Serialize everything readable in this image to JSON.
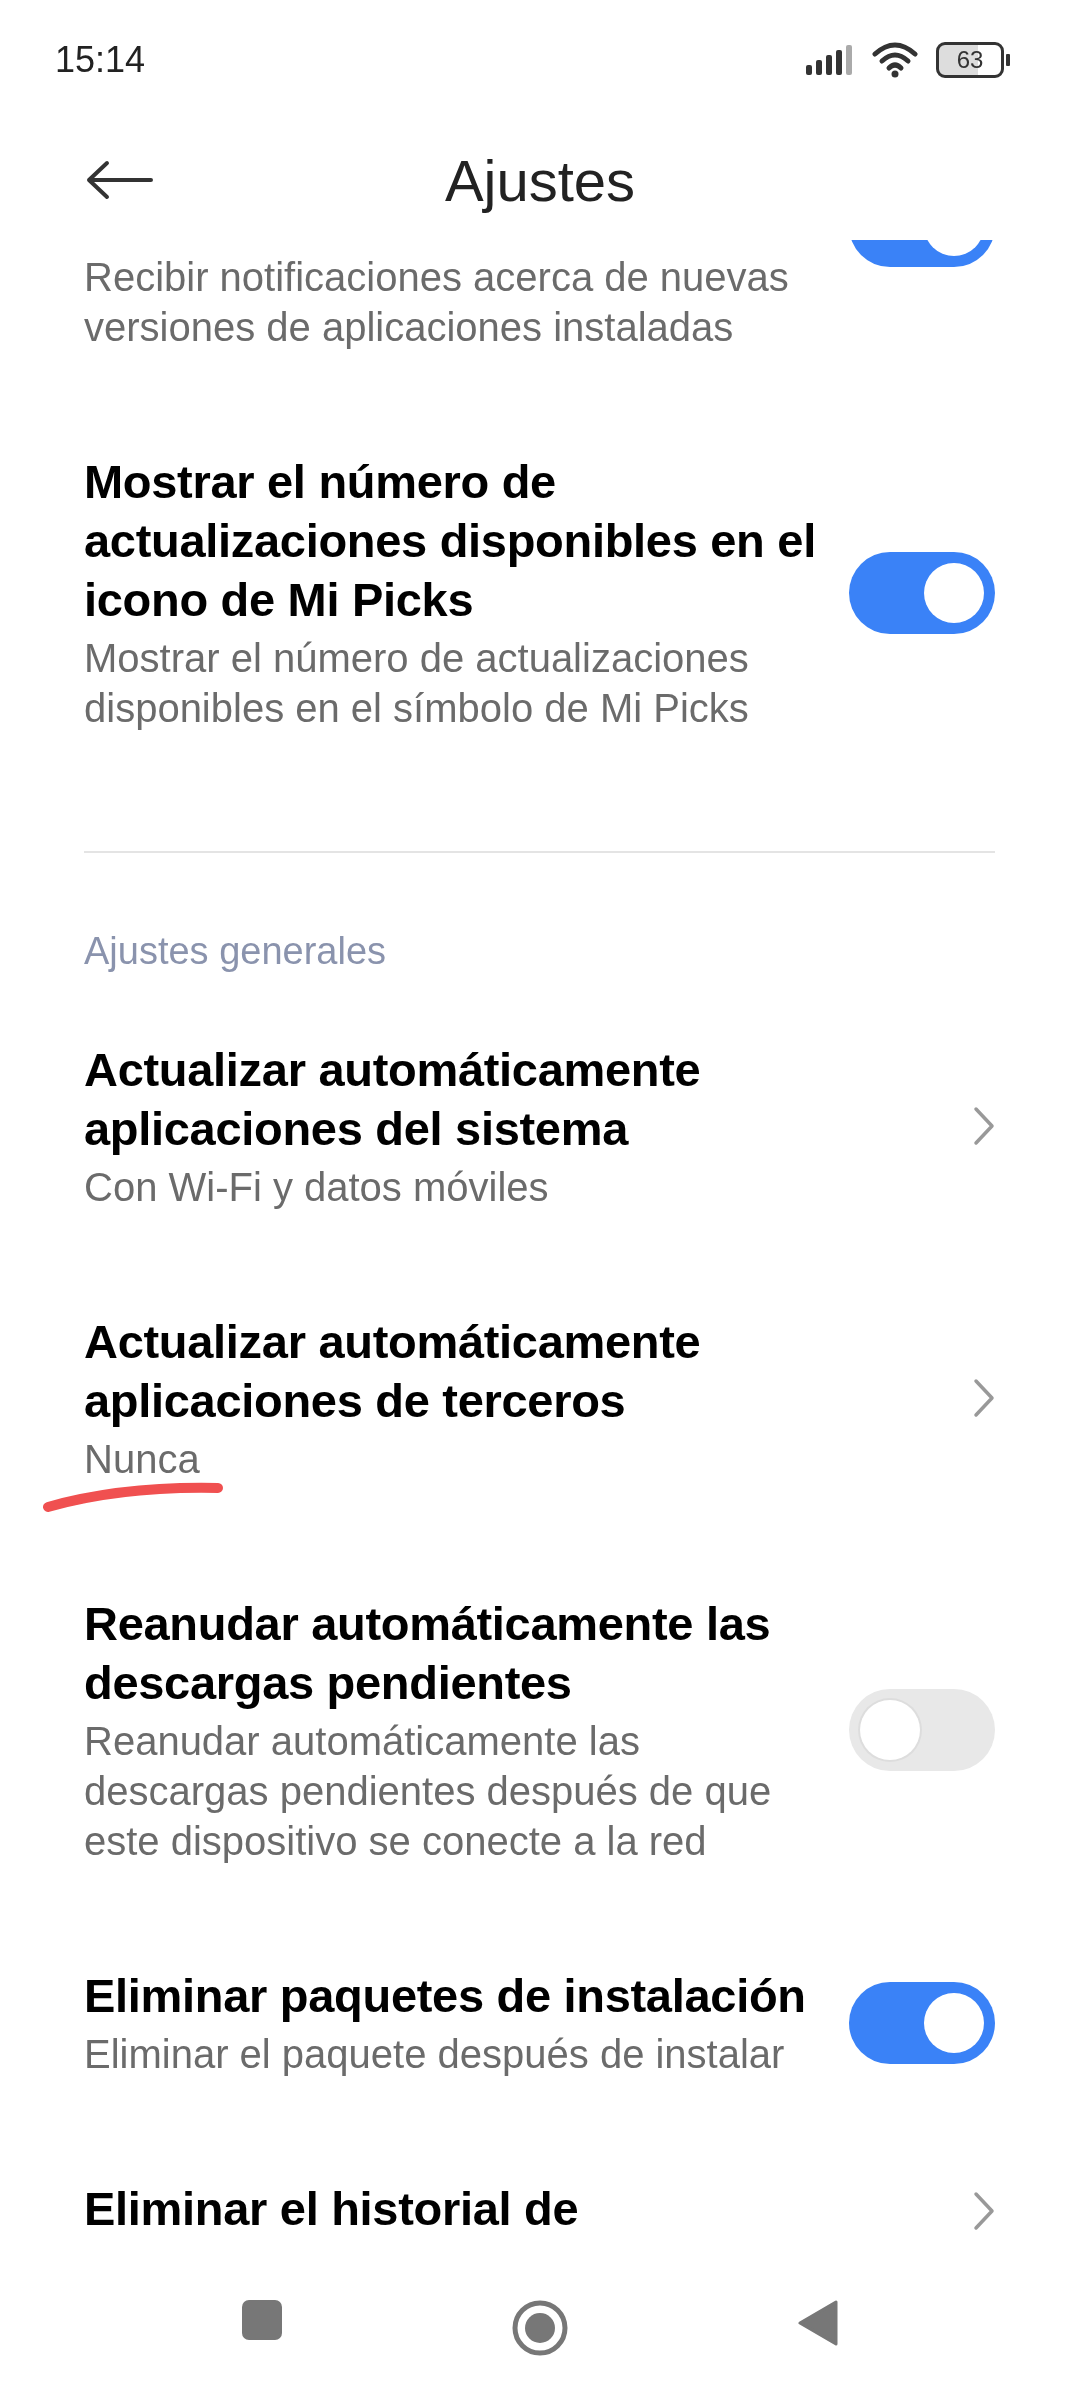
{
  "status_bar": {
    "time": "15:14",
    "battery": "63"
  },
  "header": {
    "title": "Ajustes"
  },
  "sections": [
    {
      "items": [
        {
          "kind": "toggle",
          "subtitle": "Recibir notificaciones acerca de nuevas versiones de aplicaciones instaladas",
          "on": true
        },
        {
          "kind": "toggle",
          "title": "Mostrar el número de actualizaciones disponibles en el icono de Mi Picks",
          "subtitle": "Mostrar el número de actualizaciones disponibles en el símbolo de Mi Picks",
          "on": true
        }
      ]
    },
    {
      "header": "Ajustes generales",
      "items": [
        {
          "kind": "link",
          "title": "Actualizar automáticamente aplicaciones del sistema",
          "subtitle": "Con Wi-Fi y datos móviles"
        },
        {
          "kind": "link",
          "title": "Actualizar automáticamente aplicaciones de terceros",
          "subtitle": "Nunca"
        },
        {
          "kind": "toggle",
          "title": "Reanudar automáticamente las descargas pendientes",
          "subtitle": "Reanudar automáticamente las descargas pendientes después de que este dispositivo se conecte a la red",
          "on": false
        },
        {
          "kind": "toggle",
          "title": "Eliminar paquetes de instalación",
          "subtitle": "Eliminar el paquete después de instalar",
          "on": true
        },
        {
          "kind": "link",
          "title": "Eliminar el historial de"
        }
      ]
    }
  ]
}
